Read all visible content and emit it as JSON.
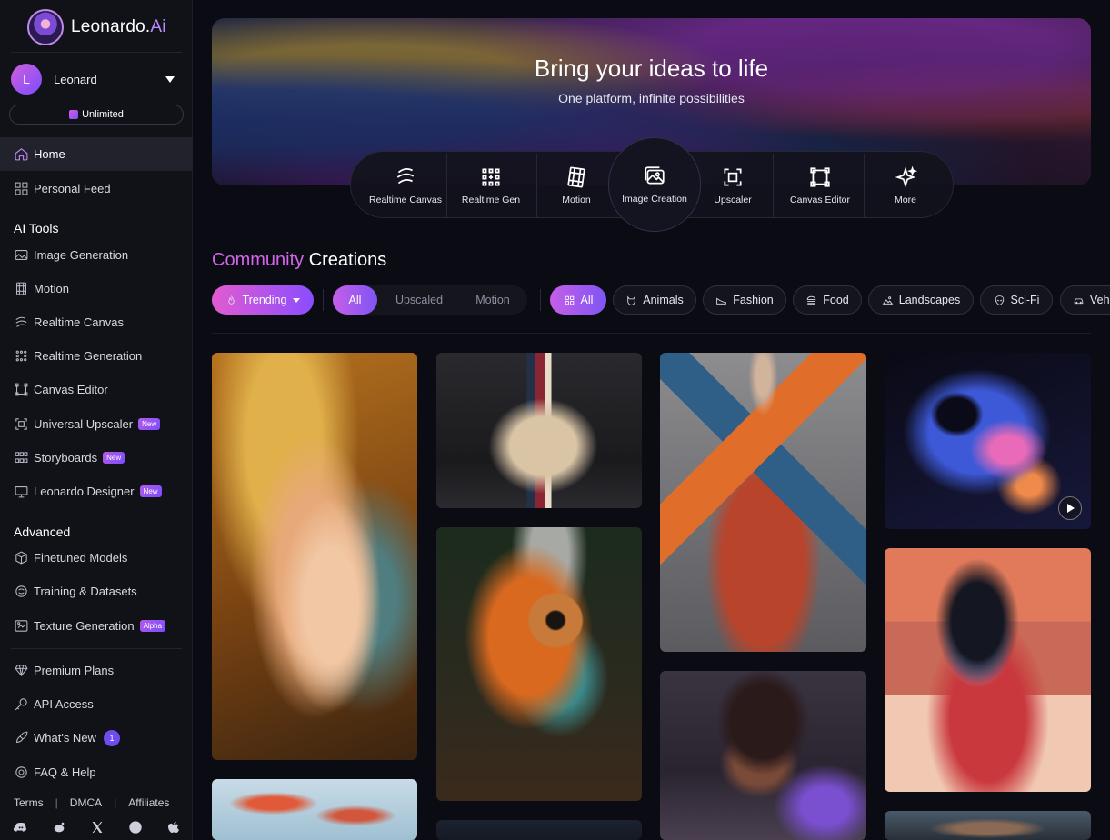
{
  "brand": {
    "name": "Leonardo.",
    "suffix": "Ai"
  },
  "user": {
    "initial": "L",
    "name": "Leonard",
    "plan": "Unlimited"
  },
  "nav": {
    "home": "Home",
    "personal_feed": "Personal Feed",
    "ai_tools_title": "AI Tools",
    "image_generation": "Image Generation",
    "motion": "Motion",
    "realtime_canvas": "Realtime Canvas",
    "realtime_generation": "Realtime Generation",
    "canvas_editor": "Canvas Editor",
    "universal_upscaler": "Universal Upscaler",
    "storyboards": "Storyboards",
    "leonardo_designer": "Leonardo Designer",
    "advanced_title": "Advanced",
    "finetuned_models": "Finetuned Models",
    "training_datasets": "Training & Datasets",
    "texture_generation": "Texture Generation",
    "premium_plans": "Premium Plans",
    "api_access": "API Access",
    "whats_new": "What's New",
    "whats_new_count": "1",
    "faq_help": "FAQ & Help",
    "badge_new": "New",
    "badge_alpha": "Alpha"
  },
  "footer": {
    "terms": "Terms",
    "dmca": "DMCA",
    "affiliates": "Affiliates",
    "separator": "|"
  },
  "hero": {
    "title": "Bring your ideas to life",
    "subtitle": "One platform, infinite possibilities",
    "tools": [
      "Realtime Canvas",
      "Realtime Gen",
      "Motion",
      "Image Creation",
      "Upscaler",
      "Canvas Editor",
      "More"
    ]
  },
  "community": {
    "title_accent": "Community",
    "title_rest": "Creations",
    "sort": "Trending",
    "type_filters": [
      "All",
      "Upscaled",
      "Motion"
    ],
    "categories": [
      "All",
      "Animals",
      "Fashion",
      "Food",
      "Landscapes",
      "Sci-Fi",
      "Veh"
    ]
  },
  "colors": {
    "accent_pink": "#e25bd1",
    "accent_purple": "#8a4dff",
    "background": "#0b0b13",
    "sidebar": "#111118"
  }
}
